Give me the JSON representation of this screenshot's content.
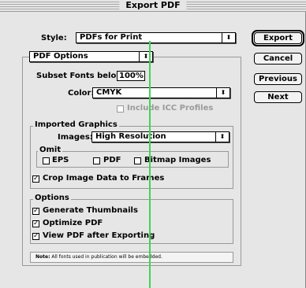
{
  "window": {
    "title": "Export PDF"
  },
  "style": {
    "label": "Style:",
    "value": "PDFs for Print"
  },
  "buttons": {
    "export": "Export",
    "cancel": "Cancel",
    "previous": "Previous",
    "next": "Next"
  },
  "panel": {
    "value": "PDF Options"
  },
  "subset": {
    "label": "Subset Fonts below:",
    "value": "100%"
  },
  "color": {
    "label": "Color:",
    "value": "CMYK",
    "icc_label": "Include ICC Profiles"
  },
  "imported": {
    "title": "Imported Graphics",
    "images_label": "Images:",
    "images_value": "High Resolution",
    "omit_title": "Omit",
    "eps": "EPS",
    "pdf": "PDF",
    "bitmap": "Bitmap Images",
    "crop_label": "Crop Image Data to Frames"
  },
  "options": {
    "title": "Options",
    "thumbnails": "Generate Thumbnails",
    "optimize": "Optimize PDF",
    "view": "View PDF after Exporting"
  },
  "note": {
    "bold": "Note:",
    "text": "All fonts used in publication will be embedded."
  }
}
